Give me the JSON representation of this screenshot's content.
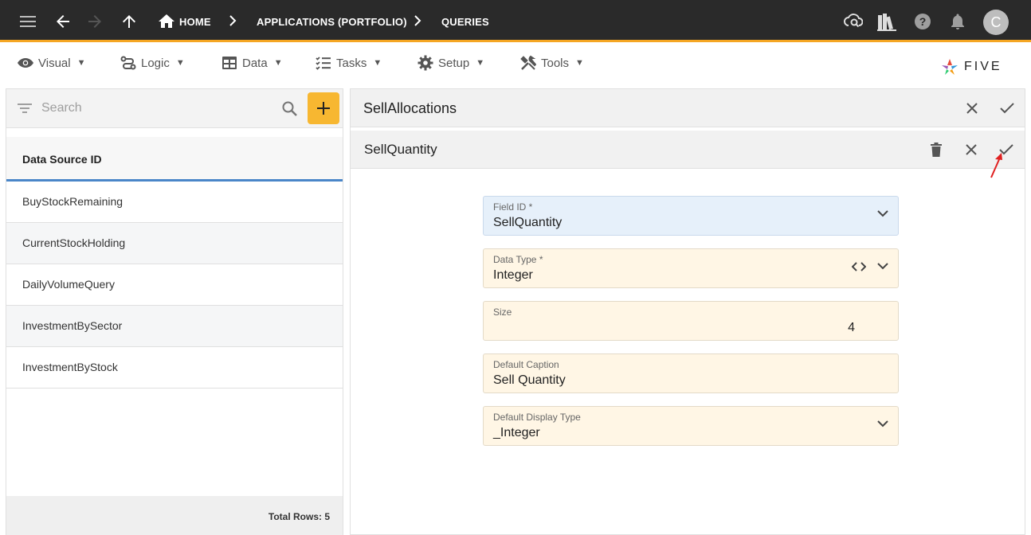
{
  "topbar": {
    "breadcrumbs": [
      "HOME",
      "APPLICATIONS (PORTFOLIO)",
      "QUERIES"
    ],
    "avatar_initial": "C",
    "icons": [
      "menu-icon",
      "back-arrow-icon",
      "forward-arrow-icon",
      "up-arrow-icon",
      "home-icon",
      "cloud-search-icon",
      "library-books-icon",
      "help-icon",
      "bell-icon"
    ],
    "accent_color": "#f5a623"
  },
  "menubar": {
    "items": [
      {
        "label": "Visual",
        "icon": "eye-icon"
      },
      {
        "label": "Logic",
        "icon": "logic-icon"
      },
      {
        "label": "Data",
        "icon": "table-icon"
      },
      {
        "label": "Tasks",
        "icon": "checklist-icon"
      },
      {
        "label": "Setup",
        "icon": "gear-icon"
      },
      {
        "label": "Tools",
        "icon": "tools-icon"
      }
    ],
    "logo_text": "FIVE"
  },
  "left": {
    "search_placeholder": "Search",
    "add_button_color": "#f7b731",
    "column_header": "Data Source ID",
    "rows": [
      "BuyStockRemaining",
      "CurrentStockHolding",
      "DailyVolumeQuery",
      "InvestmentBySector",
      "InvestmentByStock"
    ],
    "footer": "Total Rows: 5"
  },
  "right": {
    "form_title": "SellAllocations",
    "sub_title": "SellQuantity",
    "fields": [
      {
        "label": "Field ID *",
        "value": "SellQuantity"
      },
      {
        "label": "Data Type *",
        "value": "Integer"
      },
      {
        "label": "Size",
        "value": "4"
      },
      {
        "label": "Default Caption",
        "value": "Sell Quantity"
      },
      {
        "label": "Default Display Type",
        "value": "_Integer"
      }
    ]
  }
}
